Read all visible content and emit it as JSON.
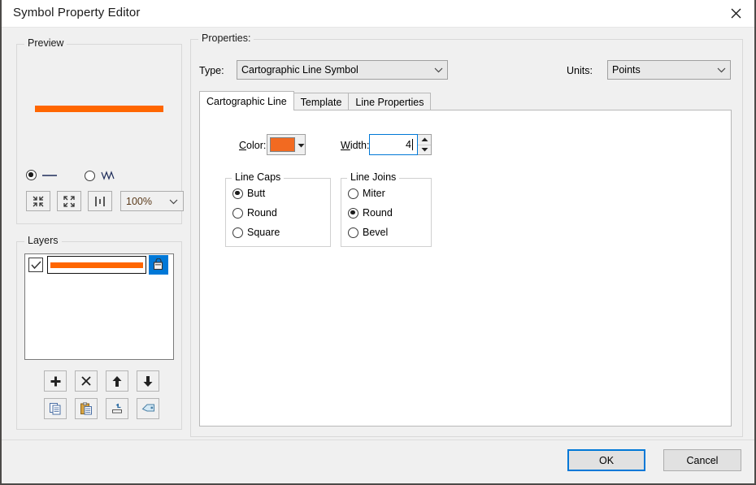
{
  "window": {
    "title": "Symbol Property Editor",
    "close_icon": "close-icon"
  },
  "preview": {
    "group_label": "Preview",
    "line_color": "#ff6600",
    "style_options": [
      {
        "icon": "straight-line-icon",
        "selected": true
      },
      {
        "icon": "zigzag-line-icon",
        "selected": false
      }
    ],
    "buttons": [
      {
        "name": "zoom-out-button",
        "icon": "collapse-arrows-icon"
      },
      {
        "name": "zoom-in-button",
        "icon": "expand-arrows-icon"
      },
      {
        "name": "actual-size-button",
        "icon": "one-to-one-icon"
      }
    ],
    "zoom_level": "100%"
  },
  "layers": {
    "group_label": "Layers",
    "items": [
      {
        "checked": true,
        "swatch_color": "#ff6600",
        "lock_icon": "lock-layer-icon",
        "lock_highlight_color": "#0078d7"
      }
    ],
    "action_buttons_row1": [
      {
        "name": "add-layer-button",
        "icon": "plus-icon"
      },
      {
        "name": "delete-layer-button",
        "icon": "x-icon"
      },
      {
        "name": "move-layer-up-button",
        "icon": "arrow-up-icon"
      },
      {
        "name": "move-layer-down-button",
        "icon": "arrow-down-icon"
      }
    ],
    "action_buttons_row2": [
      {
        "name": "copy-layer-button",
        "icon": "copy-icon"
      },
      {
        "name": "paste-layer-button",
        "icon": "paste-icon"
      },
      {
        "name": "swap-layer-button",
        "icon": "swap-icon"
      },
      {
        "name": "tag-layer-button",
        "icon": "tag-icon"
      }
    ]
  },
  "properties": {
    "group_label": "Properties:",
    "type_label": "Type:",
    "type_value": "Cartographic Line Symbol",
    "units_label": "Units:",
    "units_value": "Points",
    "tabs": [
      {
        "label": "Cartographic Line",
        "active": true
      },
      {
        "label": "Template",
        "active": false
      },
      {
        "label": "Line Properties",
        "active": false
      }
    ],
    "color_label": "Color:",
    "color_value": "#f26a21",
    "width_label": "Width:",
    "width_value": "4",
    "line_caps": {
      "label": "Line Caps",
      "options": [
        {
          "label": "Butt",
          "selected": true
        },
        {
          "label": "Round",
          "selected": false
        },
        {
          "label": "Square",
          "selected": false
        }
      ]
    },
    "line_joins": {
      "label": "Line Joins",
      "options": [
        {
          "label": "Miter",
          "selected": false
        },
        {
          "label": "Round",
          "selected": true
        },
        {
          "label": "Bevel",
          "selected": false
        }
      ]
    }
  },
  "footer": {
    "ok_label": "OK",
    "cancel_label": "Cancel",
    "focus_color": "#0078d7"
  }
}
